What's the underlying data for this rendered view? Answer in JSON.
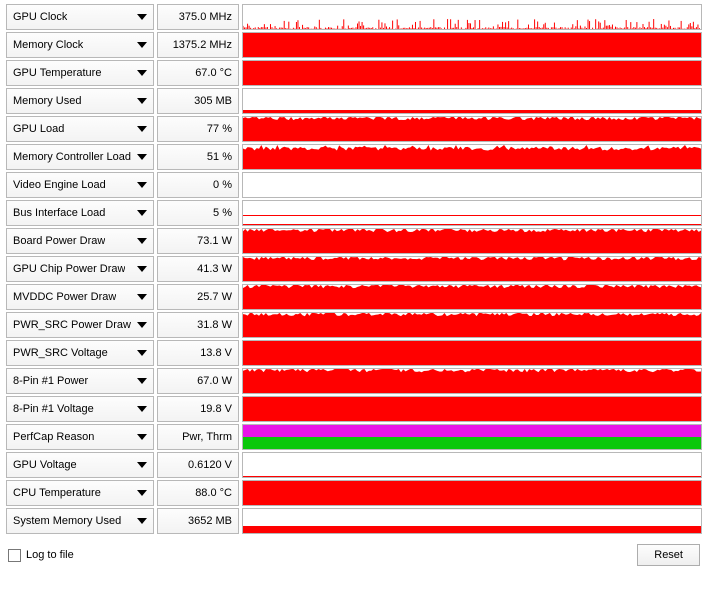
{
  "sensors": [
    {
      "label": "GPU Clock",
      "value": "375.0 MHz",
      "style": "sparkline-low"
    },
    {
      "label": "Memory Clock",
      "value": "1375.2 MHz",
      "style": "full"
    },
    {
      "label": "GPU Temperature",
      "value": "67.0 °C",
      "style": "full"
    },
    {
      "label": "Memory Used",
      "value": "305 MB",
      "style": "tiny"
    },
    {
      "label": "GPU Load",
      "value": "77 %",
      "style": "noisy-full"
    },
    {
      "label": "Memory Controller Load",
      "value": "51 %",
      "style": "noisy-most"
    },
    {
      "label": "Video Engine Load",
      "value": "0 %",
      "style": "none"
    },
    {
      "label": "Bus Interface Load",
      "value": "5 %",
      "style": "vtiny-line"
    },
    {
      "label": "Board Power Draw",
      "value": "73.1 W",
      "style": "noisy-full"
    },
    {
      "label": "GPU Chip Power Draw",
      "value": "41.3 W",
      "style": "noisy-full"
    },
    {
      "label": "MVDDC Power Draw",
      "value": "25.7 W",
      "style": "noisy-full"
    },
    {
      "label": "PWR_SRC Power Draw",
      "value": "31.8 W",
      "style": "noisy-full"
    },
    {
      "label": "PWR_SRC Voltage",
      "value": "13.8 V",
      "style": "full"
    },
    {
      "label": "8-Pin #1 Power",
      "value": "67.0 W",
      "style": "noisy-full"
    },
    {
      "label": "8-Pin #1 Voltage",
      "value": "19.8 V",
      "style": "full"
    },
    {
      "label": "PerfCap Reason",
      "value": "Pwr, Thrm",
      "style": "perfcap"
    },
    {
      "label": "GPU Voltage",
      "value": "0.6120 V",
      "style": "vtiny"
    },
    {
      "label": "CPU Temperature",
      "value": "88.0 °C",
      "style": "full"
    },
    {
      "label": "System Memory Used",
      "value": "3652 MB",
      "style": "small"
    }
  ],
  "footer": {
    "log_to_file": "Log to file",
    "reset": "Reset"
  }
}
